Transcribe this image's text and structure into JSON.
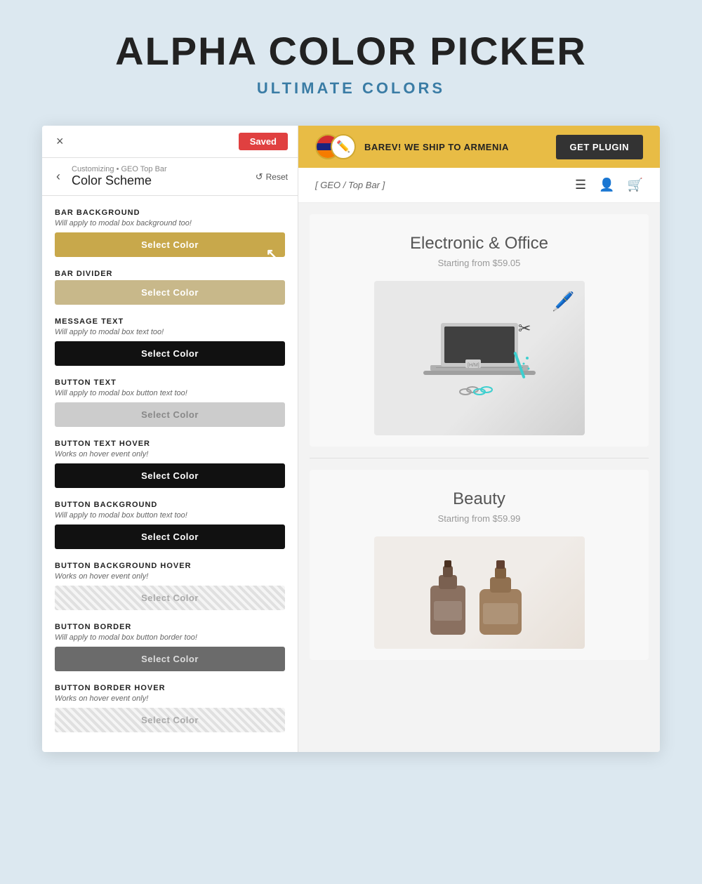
{
  "page": {
    "title": "ALPHA COLOR PICKER",
    "subtitle": "ULTIMATE COLORS"
  },
  "left_panel": {
    "close_label": "×",
    "saved_label": "Saved",
    "back_label": "‹",
    "breadcrumb_path": "Customizing • GEO Top Bar",
    "breadcrumb_current": "Color Scheme",
    "reset_label": "↺ Reset",
    "sections": [
      {
        "id": "bar-background",
        "label": "BAR BACKGROUND",
        "note": "Will apply to modal box background too!",
        "btn_label": "Select Color",
        "btn_style": "gold-dark",
        "has_cursor": true
      },
      {
        "id": "bar-divider",
        "label": "BAR DIVIDER",
        "note": null,
        "btn_label": "Select Color",
        "btn_style": "tan",
        "has_cursor": false
      },
      {
        "id": "message-text",
        "label": "MESSAGE TEXT",
        "note": "Will apply to modal box text too!",
        "btn_label": "Select Color",
        "btn_style": "black",
        "has_cursor": false
      },
      {
        "id": "button-text",
        "label": "BUTTON TEXT",
        "note": "Will apply to modal box button text too!",
        "btn_label": "Select Color",
        "btn_style": "light-gray",
        "has_cursor": false
      },
      {
        "id": "button-text-hover",
        "label": "BUTTON TEXT HOVER",
        "note": "Works on hover event only!",
        "btn_label": "Select Color",
        "btn_style": "black2",
        "has_cursor": false
      },
      {
        "id": "button-background",
        "label": "BUTTON BACKGROUND",
        "note": "Will apply to modal box button text too!",
        "btn_label": "Select Color",
        "btn_style": "black3",
        "has_cursor": false
      },
      {
        "id": "button-background-hover",
        "label": "BUTTON BACKGROUND HOVER",
        "note": "Works on hover event only!",
        "btn_label": "Select Color",
        "btn_style": "light-striped",
        "has_cursor": false
      },
      {
        "id": "button-border",
        "label": "BUTTON BORDER",
        "note": "Will apply to modal box button border too!",
        "btn_label": "Select Color",
        "btn_style": "gray-dark",
        "has_cursor": false
      },
      {
        "id": "button-border-hover",
        "label": "BUTTON BORDER HOVER",
        "note": "Works on hover event only!",
        "btn_label": "Select Color",
        "btn_style": "light-striped2",
        "has_cursor": false
      }
    ]
  },
  "right_panel": {
    "top_bar": {
      "message": "BAREV! WE SHIP TO ARMENIA",
      "btn_label": "GET PLUGIN"
    },
    "nav": {
      "logo": "[ GEO / Top Bar ]"
    },
    "products": [
      {
        "title": "Electronic & Office",
        "subtitle": "Starting from $59.05"
      },
      {
        "title": "Beauty",
        "subtitle": "Starting from $59.99"
      }
    ]
  }
}
